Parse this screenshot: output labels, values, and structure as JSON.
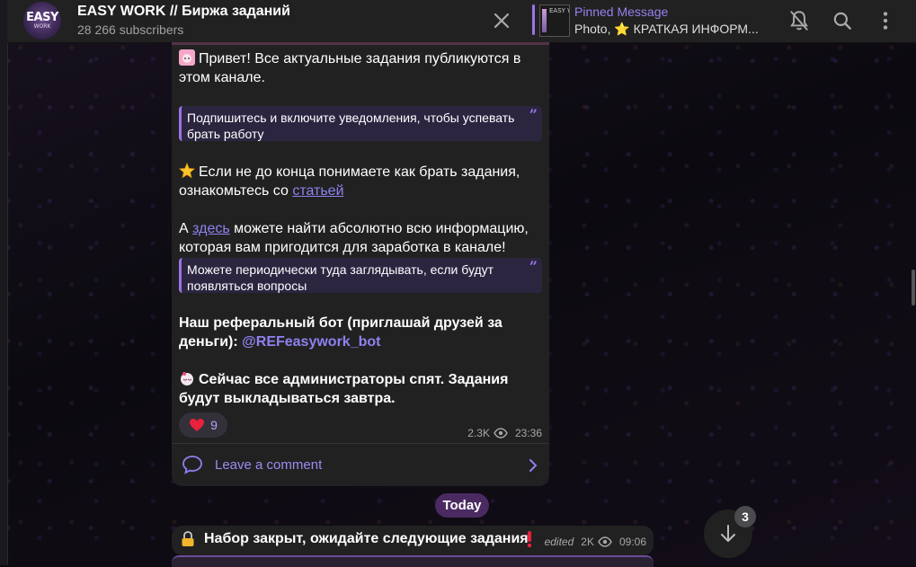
{
  "header": {
    "avatar_text": "EASY",
    "avatar_sub": "WORK",
    "title": "EASY WORK // Биржа заданий",
    "subscribers": "28 266 subscribers",
    "pinned": {
      "thumb_text": "EASY W",
      "label": "Pinned Message",
      "text": "Photo, ⭐ КРАТКАЯ ИНФОРМ..."
    },
    "icons": [
      "close-icon",
      "bell-off-icon",
      "search-icon",
      "more-vertical-icon"
    ]
  },
  "message": {
    "p1": "Привет! Все актуальные задания публикуются в этом канале.",
    "quote1": "Подпишитесь и включите уведомления, чтобы успевать брать работу",
    "p2_before": "Если не до конца понимаете как брать задания, ознакомьтесь со ",
    "p2_link": "статьей",
    "p3_before": "А ",
    "p3_link": "здесь",
    "p3_after": " можете найти абсолютно всю информацию, которая вам пригодится для заработка в канале!",
    "quote2": "Можете периодически туда заглядывать, если будут появляться вопросы",
    "p4_before": "Наш реферальный бот (приглашай друзей за деньги): ",
    "p4_mention": "@REFeasywork_bot",
    "p5": "Сейчас все администраторы спят. Задания будут выкладываться завтра.",
    "reaction": {
      "emoji": "heart",
      "count": "9"
    },
    "views": "2.3K",
    "time": "23:36",
    "comment_label": "Leave a comment"
  },
  "date_separator": "Today",
  "message2": {
    "text": "Набор закрыт, ожидайте следующие задания",
    "edited": "edited",
    "views": "2K",
    "time": "09:06"
  },
  "scroll": {
    "unread_count": "3"
  },
  "colors": {
    "accent": "#9b72e8",
    "link": "#8d82f0",
    "bubble": "#212121",
    "header": "#212121",
    "date_pill": "#4b2a61"
  }
}
